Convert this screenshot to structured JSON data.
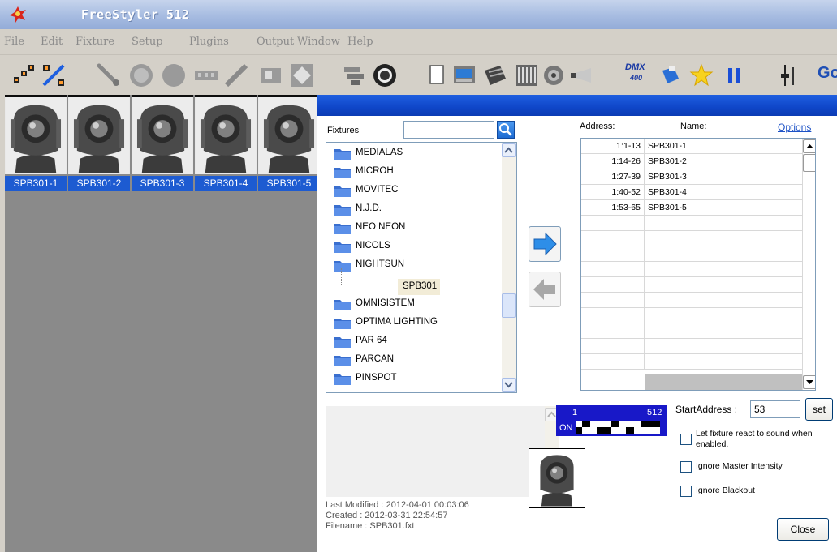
{
  "window": {
    "title": "FreeStyler 512",
    "icon": "freestyler-logo-icon"
  },
  "menu": [
    "File",
    "Edit",
    "Fixture",
    "Setup",
    "Plugins",
    "Output",
    "Window",
    "Help"
  ],
  "toolbar": {
    "dmx_label": "DMX",
    "dmx_number": "400",
    "go_label": "Go"
  },
  "fixtures": [
    {
      "name": "SPB301-1"
    },
    {
      "name": "SPB301-2"
    },
    {
      "name": "SPB301-3"
    },
    {
      "name": "SPB301-4"
    },
    {
      "name": "SPB301-5"
    }
  ],
  "dialog": {
    "fixtures_label": "Fixtures",
    "search_placeholder": "",
    "tree": [
      {
        "label": "MEDIALAS"
      },
      {
        "label": "MICROH"
      },
      {
        "label": "MOVITEC"
      },
      {
        "label": "N.J.D."
      },
      {
        "label": "NEO NEON"
      },
      {
        "label": "NICOLS"
      },
      {
        "label": "NIGHTSUN"
      },
      {
        "label": "OMNISISTEM"
      },
      {
        "label": "OPTIMA LIGHTING"
      },
      {
        "label": "PAR 64"
      },
      {
        "label": "PARCAN"
      },
      {
        "label": "PINSPOT"
      }
    ],
    "tree_selected_child": "SPB301",
    "meta": {
      "last_modified": "Last Modified : 2012-04-01 00:03:06",
      "created": "Created : 2012-03-31 22:54:57",
      "filename": "Filename : SPB301.fxt"
    },
    "grid_headers": {
      "address": "Address:",
      "name": "Name:",
      "options": "Options"
    },
    "grid_rows": [
      {
        "address": "1:1-13",
        "name": "SPB301-1"
      },
      {
        "address": "1:14-26",
        "name": "SPB301-2"
      },
      {
        "address": "1:27-39",
        "name": "SPB301-3"
      },
      {
        "address": "1:40-52",
        "name": "SPB301-4"
      },
      {
        "address": "1:53-65",
        "name": "SPB301-5"
      }
    ],
    "dmx_meter": {
      "start": "1",
      "end": "512",
      "on_label": "ON"
    },
    "start_address_label": "StartAddress :",
    "start_address_value": "53",
    "set_label": "set",
    "options_checks": [
      {
        "label": "Let fixture react to sound when enabled.",
        "checked": false
      },
      {
        "label": "Ignore Master Intensity",
        "checked": false
      },
      {
        "label": "Ignore Blackout",
        "checked": false
      }
    ],
    "close_label": "Close"
  }
}
